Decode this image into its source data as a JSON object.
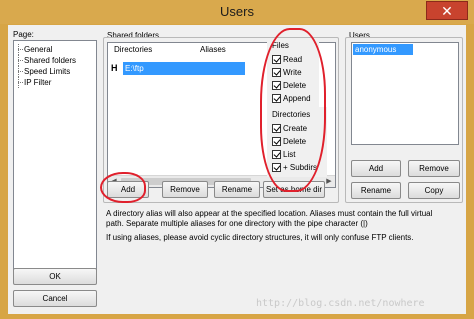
{
  "window": {
    "title": "Users",
    "close_glyph": "✕"
  },
  "sidebar": {
    "label": "Page:",
    "items": [
      {
        "label": "General"
      },
      {
        "label": "Shared folders"
      },
      {
        "label": "Speed Limits"
      },
      {
        "label": "IP Filter"
      }
    ]
  },
  "shared": {
    "group_label": "Shared folders",
    "columns": [
      "Directories",
      "Aliases"
    ],
    "rows": [
      {
        "marker": "H",
        "path": "E:\\ftp"
      }
    ],
    "buttons": {
      "add": "Add",
      "remove": "Remove",
      "rename": "Rename",
      "home": "Set as home dir"
    }
  },
  "files": {
    "label": "Files",
    "items": [
      {
        "label": "Read",
        "checked": true
      },
      {
        "label": "Write",
        "checked": true
      },
      {
        "label": "Delete",
        "checked": true
      },
      {
        "label": "Append",
        "checked": true
      }
    ]
  },
  "directories": {
    "label": "Directories",
    "items": [
      {
        "label": "Create",
        "checked": true
      },
      {
        "label": "Delete",
        "checked": true
      },
      {
        "label": "List",
        "checked": true
      },
      {
        "label": "+ Subdirs",
        "checked": true
      }
    ]
  },
  "users": {
    "label": "Users",
    "items": [
      {
        "label": "anonymous"
      }
    ],
    "buttons": {
      "add": "Add",
      "remove": "Remove",
      "rename": "Rename",
      "copy": "Copy"
    }
  },
  "info": {
    "line1": "A directory alias will also appear at the specified location. Aliases must contain the full virtual",
    "line2": "path. Separate multiple aliases for one directory with the pipe character (|)",
    "line3": "If using aliases, please avoid cyclic directory structures, it will only confuse FTP clients."
  },
  "footer": {
    "ok": "OK",
    "cancel": "Cancel"
  },
  "watermark": "http://blog.csdn.net/nowhere",
  "colors": {
    "selection": "#3399ff",
    "annotation": "#e0202c",
    "titlebar": "#d9a94d"
  }
}
